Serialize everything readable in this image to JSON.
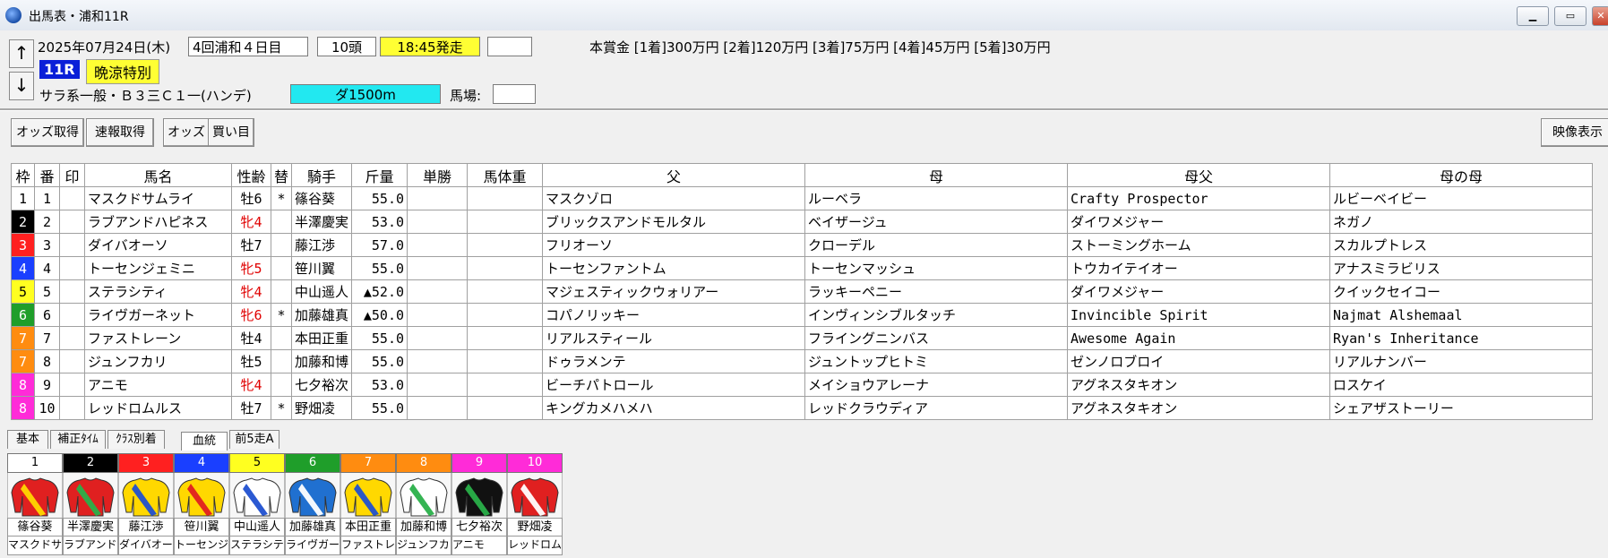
{
  "window": {
    "title": "出馬表・浦和11R"
  },
  "race": {
    "date": "2025年07月24日(木)",
    "meeting": "4回浦和４日目",
    "runners": "10頭",
    "post_time": "18:45発走",
    "extra_field": "",
    "number": "11R",
    "name": "晩涼特別",
    "conditions": "サラ系一般・Ｂ３三Ｃ１一(ハンデ)",
    "course": "ダ1500m",
    "track_label": "馬場:",
    "track_value": "",
    "prize": "本賞金 [1着]300万円 [2着]120万円 [3着]75万円 [4着]45万円 [5着]30万円"
  },
  "toolbar": {
    "odds_get": "オッズ取得",
    "quinella_get": "速報取得",
    "odds": "オッズ",
    "bets": "買い目",
    "video": "映像表示"
  },
  "columns": [
    "枠",
    "番",
    "印",
    "馬名",
    "性齢",
    "替",
    "騎手",
    "斤量",
    "単勝",
    "馬体重",
    "父",
    "母",
    "母父",
    "母の母"
  ],
  "waku_colors": {
    "1": {
      "bg": "#ffffff",
      "fg": "#000000"
    },
    "2": {
      "bg": "#000000",
      "fg": "#ffffff"
    },
    "3": {
      "bg": "#ff2020",
      "fg": "#ffffff"
    },
    "4": {
      "bg": "#1a3fff",
      "fg": "#ffffff"
    },
    "5": {
      "bg": "#ffff20",
      "fg": "#000000"
    },
    "6": {
      "bg": "#1f9e2a",
      "fg": "#ffffff"
    },
    "7": {
      "bg": "#ff8c10",
      "fg": "#ffffff"
    },
    "8": {
      "bg": "#ff2bd8",
      "fg": "#ffffff"
    }
  },
  "entries": [
    {
      "waku": "1",
      "ban": "1",
      "mark": "",
      "horse": "マスクドサムライ",
      "sexage": "牡6",
      "female": false,
      "change": "*",
      "jockey": "篠谷葵",
      "weight": "55.0",
      "win": "",
      "body": "",
      "sire": "マスクゾロ",
      "dam": "ルーベラ",
      "damsire": "Crafty Prospector",
      "damdam": "ルビーベイビー"
    },
    {
      "waku": "2",
      "ban": "2",
      "mark": "",
      "horse": "ラブアンドハピネス",
      "sexage": "牝4",
      "female": true,
      "change": "",
      "jockey": "半澤慶実",
      "weight": "53.0",
      "win": "",
      "body": "",
      "sire": "ブリックスアンドモルタル",
      "dam": "ベイザージュ",
      "damsire": "ダイワメジャー",
      "damdam": "ネガノ"
    },
    {
      "waku": "3",
      "ban": "3",
      "mark": "",
      "horse": "ダイバオーソ",
      "sexage": "牡7",
      "female": false,
      "change": "",
      "jockey": "藤江渉",
      "weight": "57.0",
      "win": "",
      "body": "",
      "sire": "フリオーソ",
      "dam": "クローデル",
      "damsire": "ストーミングホーム",
      "damdam": "スカルプトレス"
    },
    {
      "waku": "4",
      "ban": "4",
      "mark": "",
      "horse": "トーセンジェミニ",
      "sexage": "牝5",
      "female": true,
      "change": "",
      "jockey": "笹川翼",
      "weight": "55.0",
      "win": "",
      "body": "",
      "sire": "トーセンファントム",
      "dam": "トーセンマッシュ",
      "damsire": "トウカイテイオー",
      "damdam": "アナスミラビリス"
    },
    {
      "waku": "5",
      "ban": "5",
      "mark": "",
      "horse": "ステラシティ",
      "sexage": "牝4",
      "female": true,
      "change": "",
      "jockey": "中山遥人",
      "weight": "▲52.0",
      "win": "",
      "body": "",
      "sire": "マジェスティックウォリアー",
      "dam": "ラッキーペニー",
      "damsire": "ダイワメジャー",
      "damdam": "クイックセイコー"
    },
    {
      "waku": "6",
      "ban": "6",
      "mark": "",
      "horse": "ライヴガーネット",
      "sexage": "牝6",
      "female": true,
      "change": "*",
      "jockey": "加藤雄真",
      "weight": "▲50.0",
      "win": "",
      "body": "",
      "sire": "コパノリッキー",
      "dam": "インヴィンシブルタッチ",
      "damsire": "Invincible Spirit",
      "damdam": "Najmat Alshemaal"
    },
    {
      "waku": "7",
      "ban": "7",
      "mark": "",
      "horse": "ファストレーン",
      "sexage": "牡4",
      "female": false,
      "change": "",
      "jockey": "本田正重",
      "weight": "55.0",
      "win": "",
      "body": "",
      "sire": "リアルスティール",
      "dam": "フライングニンバス",
      "damsire": "Awesome Again",
      "damdam": "Ryan's Inheritance"
    },
    {
      "waku": "7",
      "ban": "8",
      "mark": "",
      "horse": "ジュンフカリ",
      "sexage": "牡5",
      "female": false,
      "change": "",
      "jockey": "加藤和博",
      "weight": "55.0",
      "win": "",
      "body": "",
      "sire": "ドゥラメンテ",
      "dam": "ジュントップヒトミ",
      "damsire": "ゼンノロブロイ",
      "damdam": "リアルナンバー"
    },
    {
      "waku": "8",
      "ban": "9",
      "mark": "",
      "horse": "アニモ",
      "sexage": "牝4",
      "female": true,
      "change": "",
      "jockey": "七夕裕次",
      "weight": "53.0",
      "win": "",
      "body": "",
      "sire": "ビーチパトロール",
      "dam": "メイショウアレーナ",
      "damsire": "アグネスタキオン",
      "damdam": "ロスケイ"
    },
    {
      "waku": "8",
      "ban": "10",
      "mark": "",
      "horse": "レッドロムルス",
      "sexage": "牡7",
      "female": false,
      "change": "*",
      "jockey": "野畑凌",
      "weight": "55.0",
      "win": "",
      "body": "",
      "sire": "キングカメハメハ",
      "dam": "レッドクラウディア",
      "damsire": "アグネスタキオン",
      "damdam": "シェアザストーリー"
    }
  ],
  "tabs": [
    {
      "label": "基本",
      "active": false
    },
    {
      "label": "補正ﾀｲﾑ",
      "active": false
    },
    {
      "label": "ｸﾗｽ別着",
      "active": false
    },
    {
      "label": "血統",
      "active": true
    },
    {
      "label": "前5走A",
      "active": false
    }
  ],
  "silks": [
    {
      "no": "1",
      "jockey": "篠谷葵",
      "horse": "マスクドサ",
      "colors": [
        "#e02020",
        "#ffd800"
      ]
    },
    {
      "no": "2",
      "jockey": "半澤慶実",
      "horse": "ラブアンド",
      "colors": [
        "#e02020",
        "#2ab04a"
      ]
    },
    {
      "no": "3",
      "jockey": "藤江渉",
      "horse": "ダイバオー",
      "colors": [
        "#ffd800",
        "#2050d0"
      ]
    },
    {
      "no": "4",
      "jockey": "笹川翼",
      "horse": "トーセンジ",
      "colors": [
        "#ffd800",
        "#e02020"
      ]
    },
    {
      "no": "5",
      "jockey": "中山遥人",
      "horse": "ステラシテ",
      "colors": [
        "#ffffff",
        "#2050d0"
      ]
    },
    {
      "no": "6",
      "jockey": "加藤雄真",
      "horse": "ライヴガー",
      "colors": [
        "#2070d0",
        "#ffffff"
      ]
    },
    {
      "no": "7",
      "jockey": "本田正重",
      "horse": "ファストレ",
      "colors": [
        "#ffd800",
        "#2050d0"
      ]
    },
    {
      "no": "8",
      "jockey": "加藤和博",
      "horse": "ジュンフカ",
      "colors": [
        "#ffffff",
        "#2ab04a"
      ]
    },
    {
      "no": "9",
      "jockey": "七夕裕次",
      "horse": "アニモ",
      "colors": [
        "#111111",
        "#2ab04a"
      ]
    },
    {
      "no": "10",
      "jockey": "野畑凌",
      "horse": "レッドロム",
      "colors": [
        "#e02020",
        "#ffffff"
      ]
    }
  ]
}
